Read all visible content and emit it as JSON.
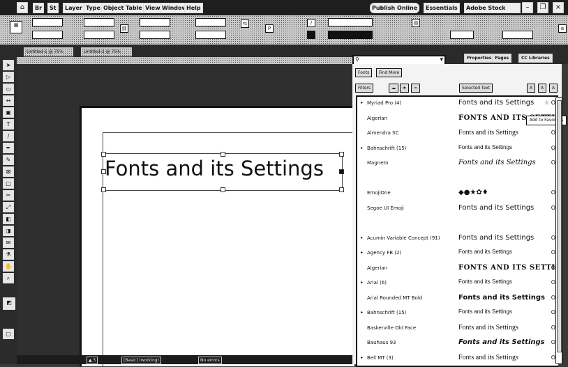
{
  "menubar": {
    "items": [
      "Br",
      "St",
      "Layer",
      "Type",
      "Object",
      "Table",
      "View",
      "Window",
      "Help"
    ],
    "publish_label": "Publish Online",
    "workspace_label": "Essentials",
    "search_placeholder": "Adobe Stock"
  },
  "tabs": {
    "doc1": "Untitled-1 @ 75%",
    "doc2": "Untitled-2 @ 75%"
  },
  "canvas": {
    "frame_text": "Fonts and its Settings"
  },
  "panel": {
    "tabs": [
      "Properties",
      "Pages",
      "CC Libraries"
    ],
    "search_value": "",
    "subtabs": [
      "Fonts",
      "Find More"
    ],
    "filter_label": "Filters",
    "selected_text_label": "Selected Text",
    "tooltip": "Add to Favorites"
  },
  "fonts": [
    {
      "name": "Myriad Pro (4)",
      "sample": "Fonts and its Settings",
      "expandable": true,
      "style": "sans"
    },
    {
      "name": "Algerian",
      "sample": "FONTS AND ITS SETTINGS",
      "expandable": false,
      "style": "caps"
    },
    {
      "name": "Almendra SC",
      "sample": "Fonts and its Settings",
      "expandable": false,
      "style": "serif"
    },
    {
      "name": "Bahnschrift (15)",
      "sample": "Fonts and its Settings",
      "expandable": true,
      "style": "narrow"
    },
    {
      "name": "Magneto",
      "sample": "Fonts and its Settings",
      "expandable": false,
      "style": "script"
    },
    {
      "name": "",
      "sample": "",
      "expandable": false,
      "style": "blank"
    },
    {
      "name": "EmojiOne",
      "sample": "◆●★✿♦",
      "expandable": false,
      "style": "sans"
    },
    {
      "name": "Segoe UI Emoji",
      "sample": "Fonts and its Settings",
      "expandable": false,
      "style": "sans"
    },
    {
      "name": "",
      "sample": "",
      "expandable": false,
      "style": "blank"
    },
    {
      "name": "Acumin Variable Concept (91)",
      "sample": "Fonts and its Settings",
      "expandable": true,
      "style": "sans"
    },
    {
      "name": "Agency FB (2)",
      "sample": "Fonts and its Settings",
      "expandable": true,
      "style": "narrow"
    },
    {
      "name": "Algerian",
      "sample": "FONTS AND ITS SETTINGS",
      "expandable": false,
      "style": "caps"
    },
    {
      "name": "Arial (6)",
      "sample": "Fonts and its Settings",
      "expandable": true,
      "style": "narrow"
    },
    {
      "name": "Arial Rounded MT Bold",
      "sample": "Fonts and its Settings",
      "expandable": false,
      "style": "bold"
    },
    {
      "name": "Bahnschrift (15)",
      "sample": "Fonts and its Settings",
      "expandable": true,
      "style": "narrow"
    },
    {
      "name": "Baskerville Old Face",
      "sample": "Fonts and its Settings",
      "expandable": false,
      "style": "serif"
    },
    {
      "name": "Bauhaus 93",
      "sample": "Fonts and its Settings",
      "expandable": false,
      "style": "bolditalic"
    },
    {
      "name": "Bell MT (3)",
      "sample": "Fonts and its Settings",
      "expandable": true,
      "style": "serif"
    }
  ],
  "status": {
    "items": [
      "▲ 5",
      "[Basic] (working)",
      "No errors"
    ]
  }
}
